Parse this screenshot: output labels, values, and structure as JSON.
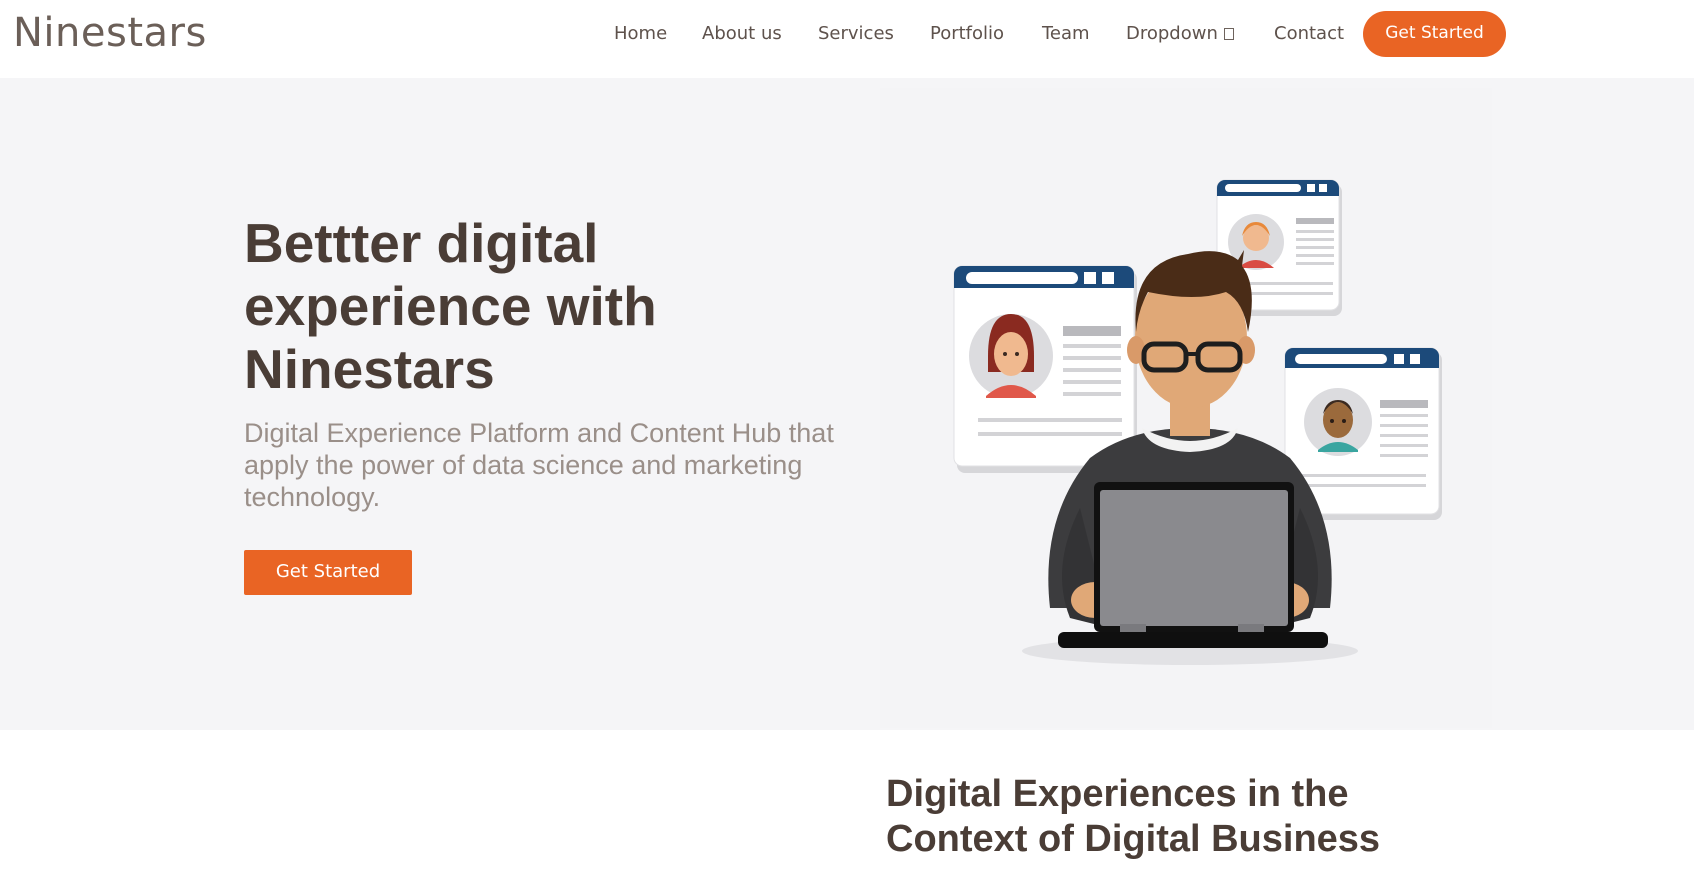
{
  "header": {
    "logo": "Ninestars",
    "nav": [
      {
        "label": "Home"
      },
      {
        "label": "About us"
      },
      {
        "label": "Services"
      },
      {
        "label": "Portfolio"
      },
      {
        "label": "Team"
      },
      {
        "label": "Dropdown"
      },
      {
        "label": "Contact"
      }
    ],
    "cta_label": "Get Started"
  },
  "hero": {
    "title": "Bettter digital experience with Ninestars",
    "subtitle": "Digital Experience Platform and Content Hub that apply the power of data science and marketing technology.",
    "button_label": "Get Started"
  },
  "section2": {
    "title": "Digital Experiences in the Context of Digital Business"
  },
  "colors": {
    "accent": "#e96424",
    "text_dark": "#4a3d36",
    "text_muted": "#9a8f89",
    "hero_bg": "#f5f5f7",
    "card_header": "#1c4a7a"
  }
}
